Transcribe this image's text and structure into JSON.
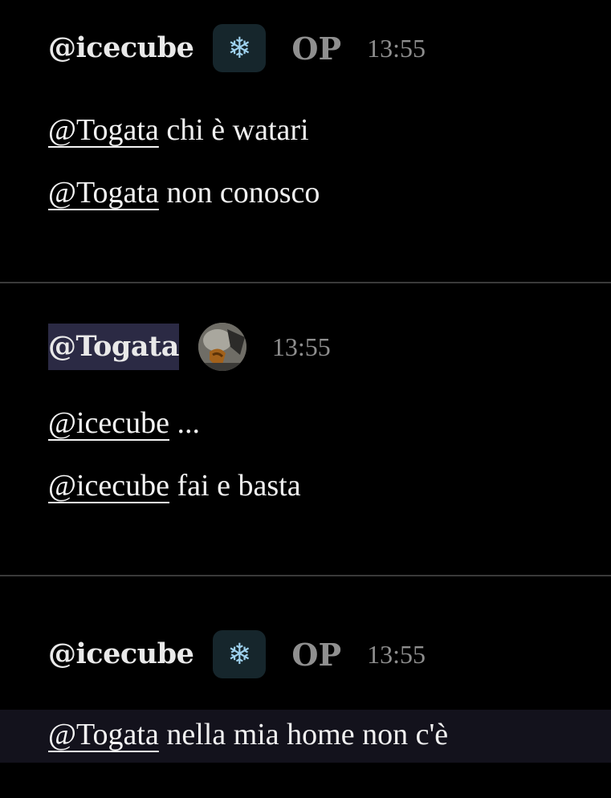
{
  "posts": [
    {
      "username": "@icecube",
      "badge_icon": "snowflake-icon",
      "badge_glyph": "❄",
      "op_label": "OP",
      "time": "13:55",
      "lines": [
        {
          "mention": "@Togata",
          "text": " chi è watari"
        },
        {
          "mention": "@Togata",
          "text": " non conosco"
        }
      ]
    },
    {
      "username": "@Togata",
      "avatar_icon": "avatar",
      "time": "13:55",
      "lines": [
        {
          "mention": "@icecube",
          "text": " ..."
        },
        {
          "mention": "@icecube",
          "text": " fai e basta"
        }
      ]
    },
    {
      "username": "@icecube",
      "badge_icon": "snowflake-icon",
      "badge_glyph": "❄",
      "op_label": "OP",
      "time": "13:55",
      "lines": [
        {
          "mention": "@Togata",
          "text": " nella mia home non c'è"
        }
      ]
    }
  ],
  "colors": {
    "background": "#000000",
    "divider": "#3a3a3a",
    "highlight": "#2b2a44",
    "badge_bg": "#16262c",
    "meta": "#8e8e8e"
  }
}
